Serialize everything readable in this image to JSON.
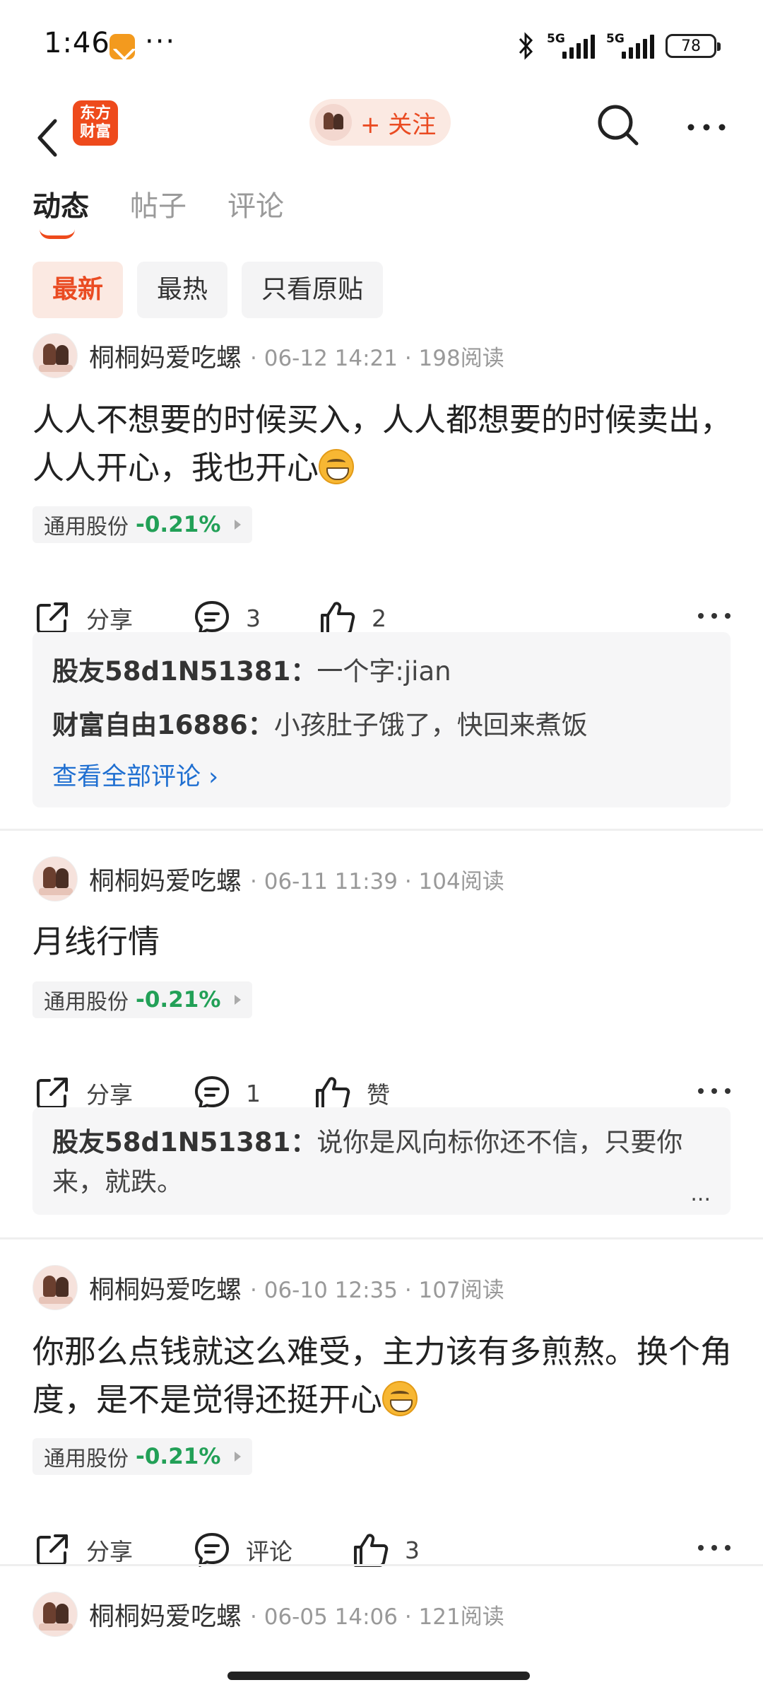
{
  "status_bar": {
    "time": "1:46",
    "dots": "···",
    "net1": "5G",
    "net2": "5G",
    "battery": "78"
  },
  "header": {
    "logo_text_line1": "东方",
    "logo_text_line2": "财富",
    "follow_label": "+ 关注",
    "accent_color": "#ea4b22"
  },
  "tabs": [
    {
      "label": "动态",
      "active": true
    },
    {
      "label": "帖子",
      "active": false
    },
    {
      "label": "评论",
      "active": false
    }
  ],
  "filters": [
    {
      "label": "最新",
      "active": true
    },
    {
      "label": "最热",
      "active": false
    },
    {
      "label": "只看原贴",
      "active": false
    }
  ],
  "posts": [
    {
      "username": "桐桐妈爱吃螺",
      "meta": "· 06-12 14:21 · 198阅读",
      "text": "人人不想要的时候买入，人人都想要的时候卖出，人人开心，我也开心",
      "stock_name": "通用股份",
      "stock_change": "-0.21%",
      "share_label": "分享",
      "comment_label": "3",
      "like_label": "2",
      "comments": [
        {
          "user": "股友58d1N51381：",
          "text": "一个字:jian"
        },
        {
          "user": "财富自由16886：",
          "text": "小孩肚子饿了，快回来煮饭"
        }
      ],
      "view_all": "查看全部评论 ›"
    },
    {
      "username": "桐桐妈爱吃螺",
      "meta": "· 06-11 11:39 · 104阅读",
      "text": "月线行情",
      "stock_name": "通用股份",
      "stock_change": "-0.21%",
      "share_label": "分享",
      "comment_label": "1",
      "like_label": "赞",
      "comments": [
        {
          "user": "股友58d1N51381：",
          "text": "说你是风向标你还不信，只要你来，就跌。"
        }
      ],
      "ellipsis": "..."
    },
    {
      "username": "桐桐妈爱吃螺",
      "meta": "· 06-10 12:35 · 107阅读",
      "text": "你那么点钱就这么难受，主力该有多煎熬。换个角度，是不是觉得还挺开心",
      "stock_name": "通用股份",
      "stock_change": "-0.21%",
      "share_label": "分享",
      "comment_label": "评论",
      "like_label": "3"
    },
    {
      "username": "桐桐妈爱吃螺",
      "meta": "· 06-05 14:06 · 121阅读"
    }
  ],
  "colors": {
    "accent": "#ea4b22",
    "stock_down": "#22a057",
    "link": "#1f6fd1"
  }
}
